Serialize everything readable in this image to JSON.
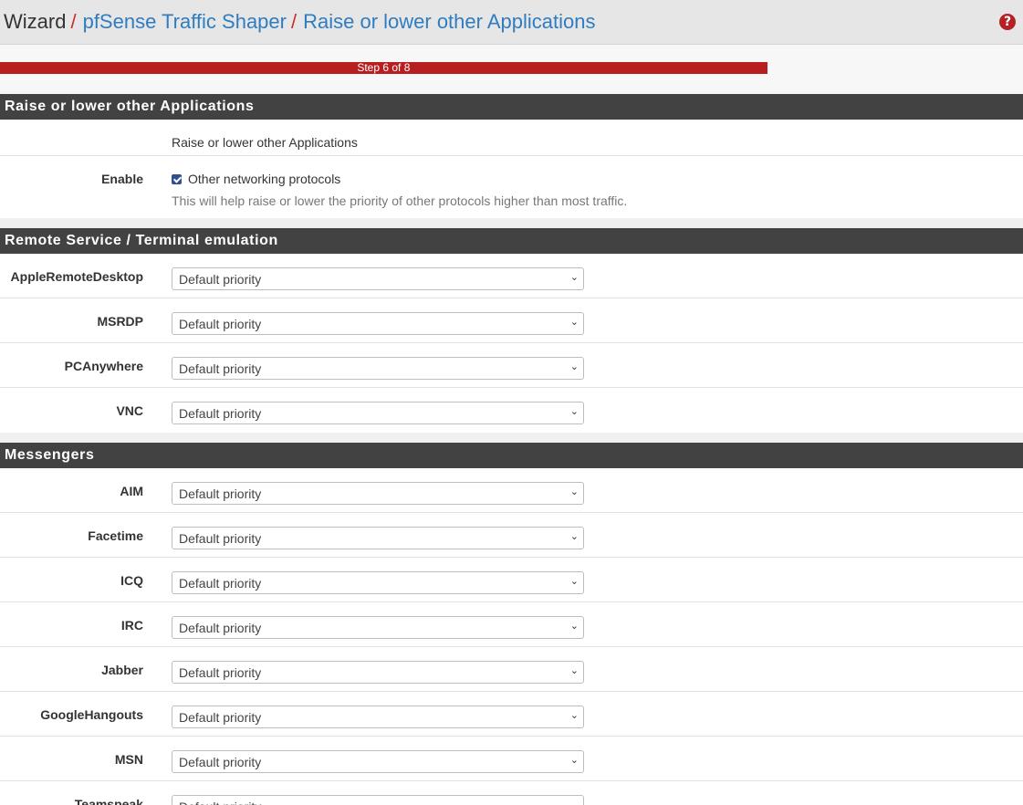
{
  "breadcrumb": {
    "root": "Wizard",
    "parent": "pfSense Traffic Shaper",
    "current": "Raise or lower other Applications"
  },
  "progress": {
    "label": "Step 6 of 8",
    "fraction": 0.75
  },
  "section_other": {
    "title": "Raise or lower other Applications",
    "description": "Raise or lower other Applications",
    "enable_label": "Enable",
    "enable_checkbox_label": "Other networking protocols",
    "enable_checked": true,
    "enable_help": "This will help raise or lower the priority of other protocols higher than most traffic."
  },
  "section_remote": {
    "title": "Remote Service / Terminal emulation",
    "rows": [
      {
        "label": "AppleRemoteDesktop",
        "value": "Default priority"
      },
      {
        "label": "MSRDP",
        "value": "Default priority"
      },
      {
        "label": "PCAnywhere",
        "value": "Default priority"
      },
      {
        "label": "VNC",
        "value": "Default priority"
      }
    ]
  },
  "section_messengers": {
    "title": "Messengers",
    "rows": [
      {
        "label": "AIM",
        "value": "Default priority"
      },
      {
        "label": "Facetime",
        "value": "Default priority"
      },
      {
        "label": "ICQ",
        "value": "Default priority"
      },
      {
        "label": "IRC",
        "value": "Default priority"
      },
      {
        "label": "Jabber",
        "value": "Default priority"
      },
      {
        "label": "GoogleHangouts",
        "value": "Default priority"
      },
      {
        "label": "MSN",
        "value": "Default priority"
      },
      {
        "label": "Teamspeak",
        "value": "Default priority"
      }
    ]
  },
  "colors": {
    "accent": "#b81e20",
    "panel_header": "#424242",
    "link": "#2f7dc1"
  }
}
